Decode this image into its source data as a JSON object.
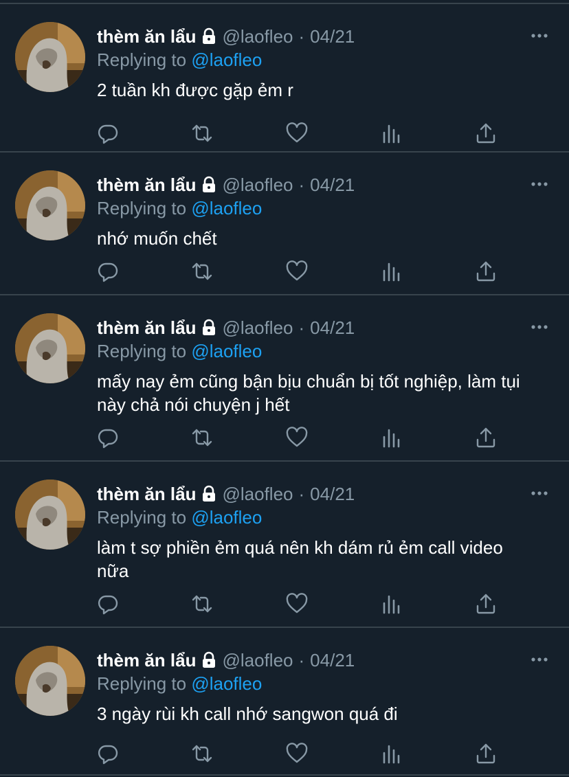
{
  "tweets": [
    {
      "name": "thèm ăn lẩu",
      "handle": "@laofleo",
      "separator": "·",
      "date": "04/21",
      "replying_prefix": "Replying to",
      "replying_to": "@laofleo",
      "text": "2 tuần kh được gặp ẻm r"
    },
    {
      "name": "thèm ăn lẩu",
      "handle": "@laofleo",
      "separator": "·",
      "date": "04/21",
      "replying_prefix": "Replying to",
      "replying_to": "@laofleo",
      "text": "nhớ muốn chết"
    },
    {
      "name": "thèm ăn lẩu",
      "handle": "@laofleo",
      "separator": "·",
      "date": "04/21",
      "replying_prefix": "Replying to",
      "replying_to": "@laofleo",
      "text": "mấy nay ẻm cũng bận bịu chuẩn bị tốt nghiệp, làm tụi này chả nói chuyện j hết"
    },
    {
      "name": "thèm ăn lẩu",
      "handle": "@laofleo",
      "separator": "·",
      "date": "04/21",
      "replying_prefix": "Replying to",
      "replying_to": "@laofleo",
      "text": "làm t sợ phiền ẻm quá nên kh dám rủ ẻm call video nữa"
    },
    {
      "name": "thèm ăn lẩu",
      "handle": "@laofleo",
      "separator": "·",
      "date": "04/21",
      "replying_prefix": "Replying to",
      "replying_to": "@laofleo",
      "text": "3 ngày rùi kh call nhớ sangwon quá đi"
    }
  ],
  "icons": {
    "lock": "lock-icon",
    "more": "more-icon",
    "reply": "reply-icon",
    "retweet": "retweet-icon",
    "like": "heart-icon",
    "analytics": "analytics-icon",
    "share": "share-icon"
  },
  "colors": {
    "background": "#15202b",
    "divider": "#38444d",
    "secondary_text": "#8899a6",
    "link": "#1da1f2",
    "primary_text": "#ffffff"
  }
}
